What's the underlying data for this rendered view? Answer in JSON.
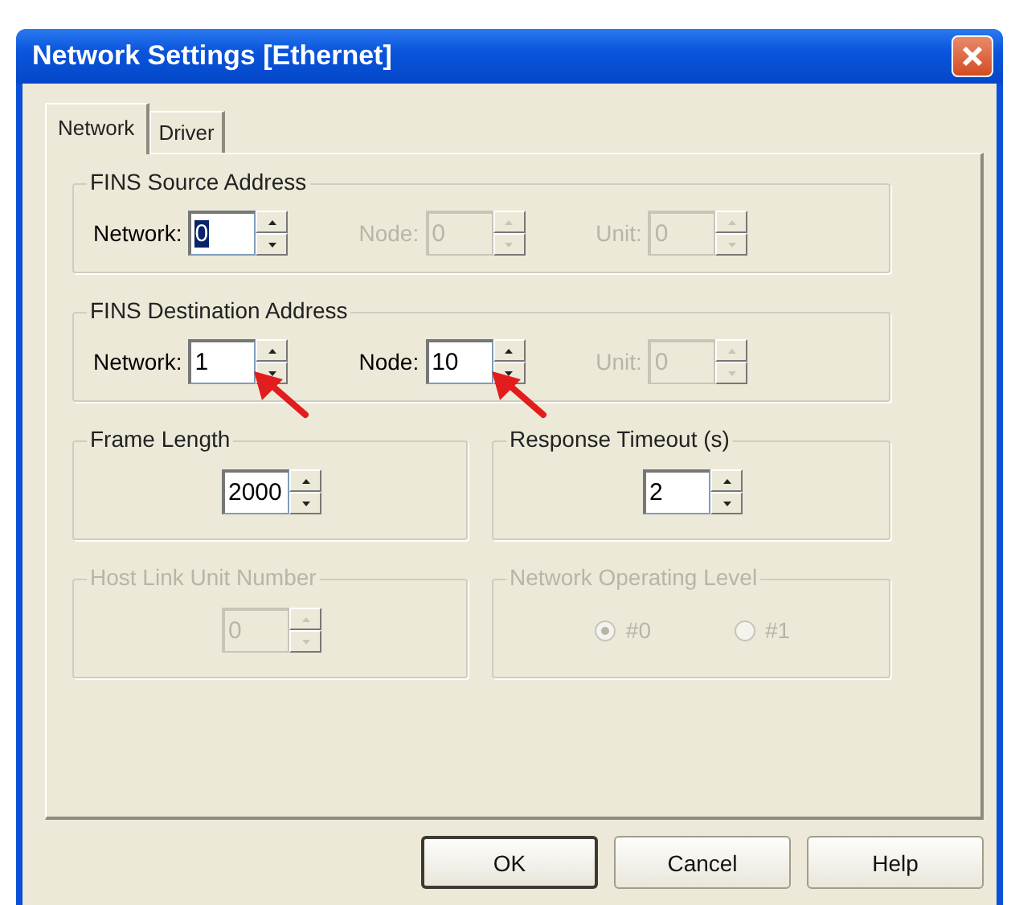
{
  "window": {
    "title": "Network Settings [Ethernet]"
  },
  "tabs": [
    {
      "label": "Network",
      "selected": true
    },
    {
      "label": "Driver",
      "selected": false
    }
  ],
  "groups": [
    {
      "kind": "address",
      "title": "FINS Source Address",
      "disabled": false,
      "fields": [
        {
          "label": "Network:",
          "value": "0",
          "disabled": false,
          "text_selected": true,
          "pointed": false
        },
        {
          "label": "Node:",
          "value": "0",
          "disabled": true,
          "text_selected": false,
          "pointed": false
        },
        {
          "label": "Unit:",
          "value": "0",
          "disabled": true,
          "text_selected": false,
          "pointed": false
        }
      ]
    },
    {
      "kind": "address",
      "title": "FINS Destination Address",
      "disabled": false,
      "fields": [
        {
          "label": "Network:",
          "value": "1",
          "disabled": false,
          "text_selected": false,
          "pointed": true
        },
        {
          "label": "Node:",
          "value": "10",
          "disabled": false,
          "text_selected": false,
          "pointed": true
        },
        {
          "label": "Unit:",
          "value": "0",
          "disabled": true,
          "text_selected": false,
          "pointed": false
        }
      ]
    },
    {
      "kind": "single",
      "title": "Frame Length",
      "disabled": false,
      "fields": [
        {
          "value": "2000",
          "disabled": false,
          "text_selected": false,
          "pointed": false
        }
      ]
    },
    {
      "kind": "single",
      "title": "Response Timeout (s)",
      "disabled": false,
      "fields": [
        {
          "value": "2",
          "disabled": false,
          "text_selected": false,
          "pointed": false
        }
      ]
    },
    {
      "kind": "single",
      "title": "Host Link Unit Number",
      "disabled": true,
      "fields": [
        {
          "value": "0",
          "disabled": true,
          "text_selected": false,
          "pointed": false
        }
      ]
    },
    {
      "kind": "radios",
      "title": "Network Operating Level",
      "disabled": true,
      "options": [
        {
          "label": "#0",
          "selected": true,
          "disabled": true
        },
        {
          "label": "#1",
          "selected": false,
          "disabled": true
        }
      ]
    }
  ],
  "buttons": [
    {
      "label": "OK",
      "default": true
    },
    {
      "label": "Cancel",
      "default": false
    },
    {
      "label": "Help",
      "default": false
    }
  ]
}
